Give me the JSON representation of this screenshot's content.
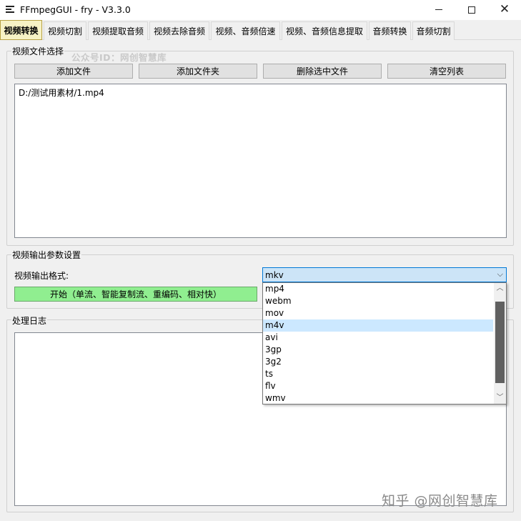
{
  "window": {
    "title": "FFmpegGUI - fry - V3.3.0",
    "minimize_icon": "minimize-icon",
    "maximize_icon": "maximize-icon",
    "close_icon": "close-icon",
    "close_glyph": "✕"
  },
  "tabs": [
    {
      "label": "视频转换",
      "active": true
    },
    {
      "label": "视频切割"
    },
    {
      "label": "视频提取音频"
    },
    {
      "label": "视频去除音频"
    },
    {
      "label": "视频、音频倍速"
    },
    {
      "label": "视频、音频信息提取"
    },
    {
      "label": "音频转换"
    },
    {
      "label": "音频切割"
    }
  ],
  "file_group": {
    "label": "视频文件选择",
    "watermark": "公众号ID：网创智慧库",
    "buttons": {
      "add_file": "添加文件",
      "add_folder": "添加文件夹",
      "remove_selected": "删除选中文件",
      "clear_list": "清空列表"
    },
    "files": [
      "D:/测试用素材/1.mp4"
    ]
  },
  "output_group": {
    "label": "视频输出参数设置",
    "format_label": "视频输出格式:",
    "format_value": "mkv",
    "start_button": "开始（单流、智能复制流、重编码、相对快）",
    "dropdown_options": [
      "mp4",
      "webm",
      "mov",
      "m4v",
      "avi",
      "3gp",
      "3g2",
      "ts",
      "flv",
      "wmv"
    ],
    "highlighted_option": "m4v",
    "arrow_down": "⌵",
    "scroll_up": "︿",
    "scroll_down": "﹀"
  },
  "log_group": {
    "label": "处理日志"
  },
  "footer_watermark": "知乎 @网创智慧库"
}
